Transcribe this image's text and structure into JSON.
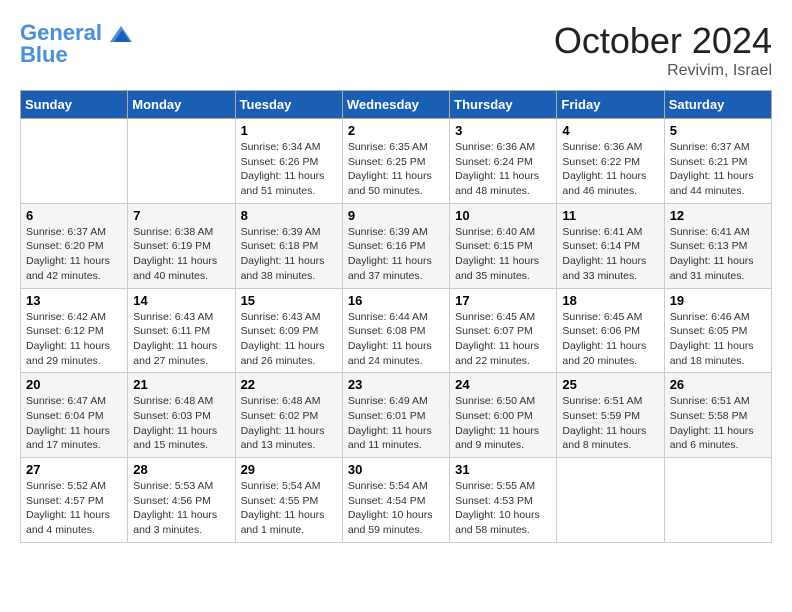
{
  "logo": {
    "line1": "General",
    "line2": "Blue"
  },
  "title": "October 2024",
  "location": "Revivim, Israel",
  "days_header": [
    "Sunday",
    "Monday",
    "Tuesday",
    "Wednesday",
    "Thursday",
    "Friday",
    "Saturday"
  ],
  "weeks": [
    [
      {
        "day": "",
        "info": ""
      },
      {
        "day": "",
        "info": ""
      },
      {
        "day": "1",
        "info": "Sunrise: 6:34 AM\nSunset: 6:26 PM\nDaylight: 11 hours and 51 minutes."
      },
      {
        "day": "2",
        "info": "Sunrise: 6:35 AM\nSunset: 6:25 PM\nDaylight: 11 hours and 50 minutes."
      },
      {
        "day": "3",
        "info": "Sunrise: 6:36 AM\nSunset: 6:24 PM\nDaylight: 11 hours and 48 minutes."
      },
      {
        "day": "4",
        "info": "Sunrise: 6:36 AM\nSunset: 6:22 PM\nDaylight: 11 hours and 46 minutes."
      },
      {
        "day": "5",
        "info": "Sunrise: 6:37 AM\nSunset: 6:21 PM\nDaylight: 11 hours and 44 minutes."
      }
    ],
    [
      {
        "day": "6",
        "info": "Sunrise: 6:37 AM\nSunset: 6:20 PM\nDaylight: 11 hours and 42 minutes."
      },
      {
        "day": "7",
        "info": "Sunrise: 6:38 AM\nSunset: 6:19 PM\nDaylight: 11 hours and 40 minutes."
      },
      {
        "day": "8",
        "info": "Sunrise: 6:39 AM\nSunset: 6:18 PM\nDaylight: 11 hours and 38 minutes."
      },
      {
        "day": "9",
        "info": "Sunrise: 6:39 AM\nSunset: 6:16 PM\nDaylight: 11 hours and 37 minutes."
      },
      {
        "day": "10",
        "info": "Sunrise: 6:40 AM\nSunset: 6:15 PM\nDaylight: 11 hours and 35 minutes."
      },
      {
        "day": "11",
        "info": "Sunrise: 6:41 AM\nSunset: 6:14 PM\nDaylight: 11 hours and 33 minutes."
      },
      {
        "day": "12",
        "info": "Sunrise: 6:41 AM\nSunset: 6:13 PM\nDaylight: 11 hours and 31 minutes."
      }
    ],
    [
      {
        "day": "13",
        "info": "Sunrise: 6:42 AM\nSunset: 6:12 PM\nDaylight: 11 hours and 29 minutes."
      },
      {
        "day": "14",
        "info": "Sunrise: 6:43 AM\nSunset: 6:11 PM\nDaylight: 11 hours and 27 minutes."
      },
      {
        "day": "15",
        "info": "Sunrise: 6:43 AM\nSunset: 6:09 PM\nDaylight: 11 hours and 26 minutes."
      },
      {
        "day": "16",
        "info": "Sunrise: 6:44 AM\nSunset: 6:08 PM\nDaylight: 11 hours and 24 minutes."
      },
      {
        "day": "17",
        "info": "Sunrise: 6:45 AM\nSunset: 6:07 PM\nDaylight: 11 hours and 22 minutes."
      },
      {
        "day": "18",
        "info": "Sunrise: 6:45 AM\nSunset: 6:06 PM\nDaylight: 11 hours and 20 minutes."
      },
      {
        "day": "19",
        "info": "Sunrise: 6:46 AM\nSunset: 6:05 PM\nDaylight: 11 hours and 18 minutes."
      }
    ],
    [
      {
        "day": "20",
        "info": "Sunrise: 6:47 AM\nSunset: 6:04 PM\nDaylight: 11 hours and 17 minutes."
      },
      {
        "day": "21",
        "info": "Sunrise: 6:48 AM\nSunset: 6:03 PM\nDaylight: 11 hours and 15 minutes."
      },
      {
        "day": "22",
        "info": "Sunrise: 6:48 AM\nSunset: 6:02 PM\nDaylight: 11 hours and 13 minutes."
      },
      {
        "day": "23",
        "info": "Sunrise: 6:49 AM\nSunset: 6:01 PM\nDaylight: 11 hours and 11 minutes."
      },
      {
        "day": "24",
        "info": "Sunrise: 6:50 AM\nSunset: 6:00 PM\nDaylight: 11 hours and 9 minutes."
      },
      {
        "day": "25",
        "info": "Sunrise: 6:51 AM\nSunset: 5:59 PM\nDaylight: 11 hours and 8 minutes."
      },
      {
        "day": "26",
        "info": "Sunrise: 6:51 AM\nSunset: 5:58 PM\nDaylight: 11 hours and 6 minutes."
      }
    ],
    [
      {
        "day": "27",
        "info": "Sunrise: 5:52 AM\nSunset: 4:57 PM\nDaylight: 11 hours and 4 minutes."
      },
      {
        "day": "28",
        "info": "Sunrise: 5:53 AM\nSunset: 4:56 PM\nDaylight: 11 hours and 3 minutes."
      },
      {
        "day": "29",
        "info": "Sunrise: 5:54 AM\nSunset: 4:55 PM\nDaylight: 11 hours and 1 minute."
      },
      {
        "day": "30",
        "info": "Sunrise: 5:54 AM\nSunset: 4:54 PM\nDaylight: 10 hours and 59 minutes."
      },
      {
        "day": "31",
        "info": "Sunrise: 5:55 AM\nSunset: 4:53 PM\nDaylight: 10 hours and 58 minutes."
      },
      {
        "day": "",
        "info": ""
      },
      {
        "day": "",
        "info": ""
      }
    ]
  ]
}
